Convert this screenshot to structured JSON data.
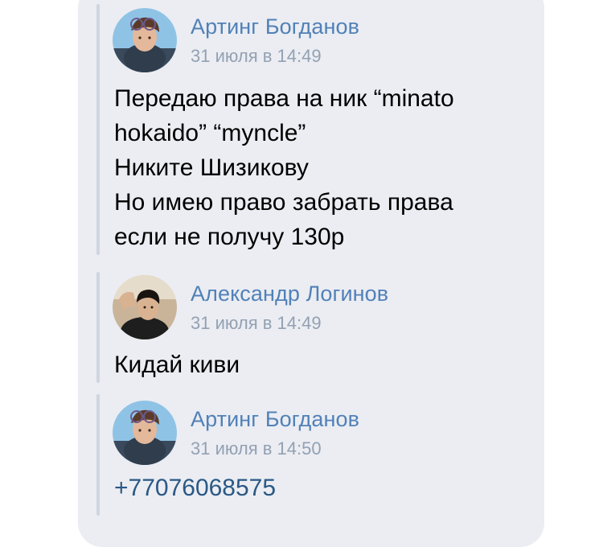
{
  "messages": [
    {
      "author": "Артинг Богданов",
      "time": "31 июля в 14:49",
      "lines": [
        "Передаю права на ник “minato",
        "hokaido” “myncle”",
        "Никите Шизикову",
        "Но имею право забрать права",
        "если не получу 130р"
      ]
    },
    {
      "author": "Александр Логинов",
      "time": "31 июля в 14:49",
      "lines": [
        "Кидай киви"
      ]
    },
    {
      "author": "Артинг Богданов",
      "time": "31 июля в 14:50",
      "phone": "+77076068575"
    }
  ],
  "colors": {
    "bubble": "#ebedf2",
    "author": "#5181b8",
    "time": "#93a1b3",
    "link": "#2a5885",
    "forward_line": "#cfd6e0"
  }
}
